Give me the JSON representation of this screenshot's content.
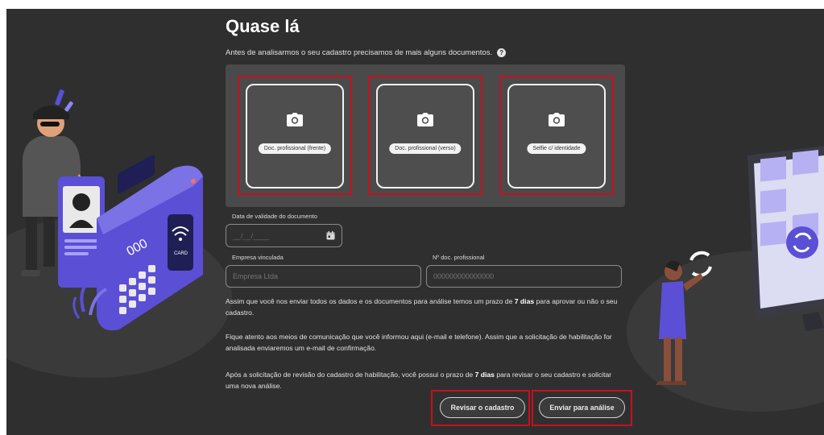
{
  "page": {
    "title": "Quase lá",
    "subtitle": "Antes de analisarmos o seu cadastro precisamos de mais alguns documentos.",
    "help_icon": "question-circle-icon"
  },
  "uploads": [
    {
      "label": "Doc. profissional (frente)",
      "icon": "camera-icon"
    },
    {
      "label": "Doc. profissional (verso)",
      "icon": "camera-icon"
    },
    {
      "label": "Selfie c/ identidade",
      "icon": "camera-icon"
    }
  ],
  "form": {
    "validity_label": "Data de validade do documento",
    "validity_placeholder": "__/__/____",
    "company_label": "Empresa vinculada",
    "company_placeholder": "Empresa Ltda",
    "doc_number_label": "Nº doc. profissional",
    "doc_number_placeholder": "000000000000000"
  },
  "info": {
    "p1_a": "Assim que você nos enviar todos os dados e os documentos para análise temos um prazo de ",
    "p1_bold": "7 dias",
    "p1_b": " para aprovar ou não o seu cadastro.",
    "p2": "Fique atento aos meios de comunicação que você informou aqui (e-mail e telefone). Assim que a solicitação de habilitação for analisada enviaremos um e-mail de confirmação.",
    "p3_a": "Após a solicitação de revisão do cadastro de habilitação, você possui o prazo de ",
    "p3_bold": "7 dias",
    "p3_b": " para revisar o seu cadastro e solicitar uma nova análise."
  },
  "illustration": {
    "keypad_display": "000",
    "card_text": "CARD"
  },
  "actions": {
    "review_label": "Revisar o cadastro",
    "submit_label": "Enviar para análise"
  },
  "colors": {
    "background": "#2f2f2f",
    "highlight": "#c8101e",
    "accent_purple": "#5b4fd6"
  }
}
